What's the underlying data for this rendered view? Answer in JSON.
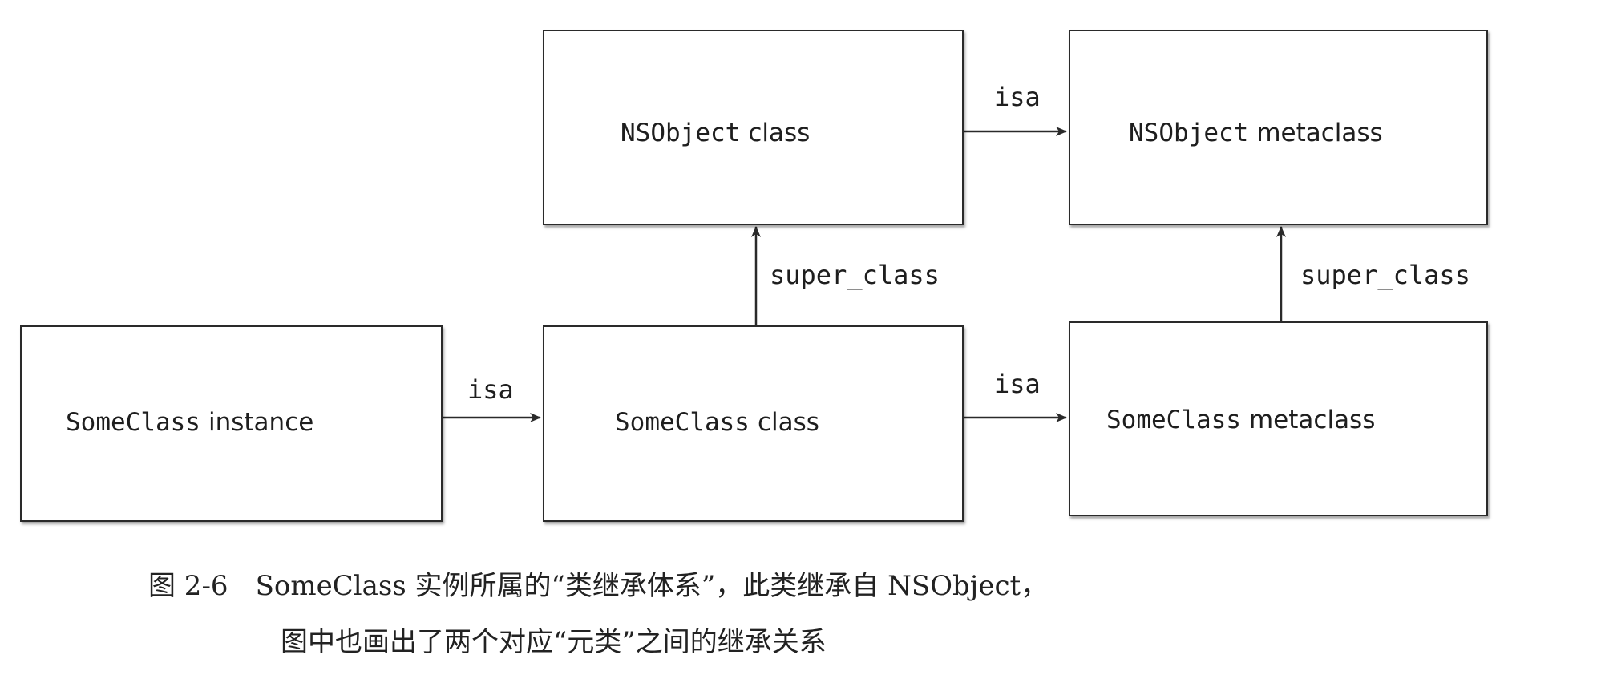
{
  "nodes": {
    "someclass_instance": {
      "name": "SomeClass",
      "kind": "instance"
    },
    "someclass_class": {
      "name": "SomeClass",
      "kind": "class"
    },
    "someclass_metaclass": {
      "name": "SomeClass",
      "kind": "metaclass"
    },
    "nsobject_class": {
      "name": "NSObject",
      "kind": "class"
    },
    "nsobject_metaclass": {
      "name": "NSObject",
      "kind": "metaclass"
    }
  },
  "edges": {
    "isa_instance_to_class": "isa",
    "isa_class_to_metaclass": "isa",
    "isa_nsobject_class_to_metaclass": "isa",
    "super_class_someclass_to_nsobject": "super_class",
    "super_class_metaclass_to_nsobject_metaclass": "super_class"
  },
  "caption": {
    "figure_number": "图 2-6",
    "line1": "SomeClass 实例所属的“类继承体系”，此类继承自 NSObject，",
    "line2": "图中也画出了两个对应“元类”之间的继承关系"
  }
}
